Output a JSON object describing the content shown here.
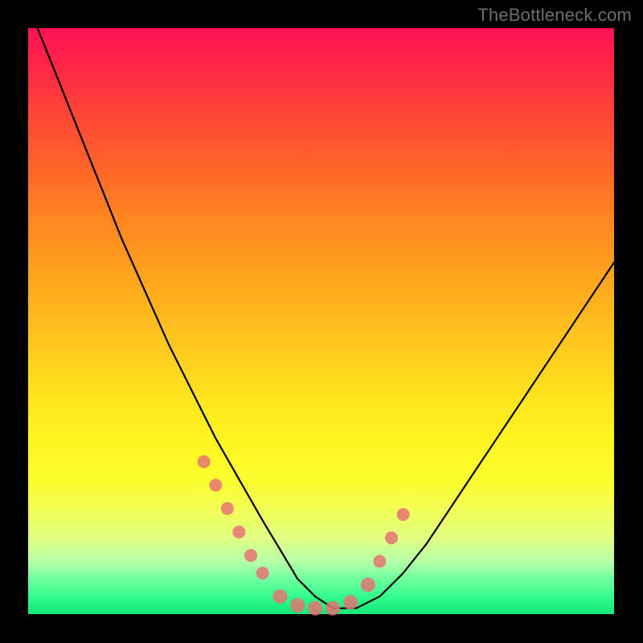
{
  "watermark": "TheBottleneck.com",
  "chart_data": {
    "type": "line",
    "title": "",
    "xlabel": "",
    "ylabel": "",
    "xlim": [
      0,
      100
    ],
    "ylim": [
      0,
      100
    ],
    "grid": false,
    "series": [
      {
        "name": "bottleneck-curve",
        "color": "#000000",
        "x": [
          0,
          4,
          8,
          12,
          16,
          20,
          24,
          28,
          32,
          36,
          40,
          43,
          46,
          49,
          52,
          56,
          60,
          64,
          68,
          72,
          76,
          80,
          84,
          88,
          92,
          96,
          100
        ],
        "values": [
          104,
          94,
          84,
          74,
          64,
          55,
          46,
          38,
          30,
          23,
          16,
          11,
          6,
          3,
          1,
          1,
          3,
          7,
          12,
          18,
          24,
          30,
          36,
          42,
          48,
          54,
          60
        ]
      }
    ],
    "markers": {
      "name": "highlighted-points",
      "color": "#e57373",
      "points": [
        {
          "x": 30,
          "y": 26
        },
        {
          "x": 32,
          "y": 22
        },
        {
          "x": 34,
          "y": 18
        },
        {
          "x": 36,
          "y": 14
        },
        {
          "x": 38,
          "y": 10
        },
        {
          "x": 40,
          "y": 7
        },
        {
          "x": 43,
          "y": 3
        },
        {
          "x": 46,
          "y": 1.5
        },
        {
          "x": 49,
          "y": 1
        },
        {
          "x": 52,
          "y": 1
        },
        {
          "x": 55,
          "y": 2
        },
        {
          "x": 58,
          "y": 5
        },
        {
          "x": 60,
          "y": 9
        },
        {
          "x": 62,
          "y": 13
        },
        {
          "x": 64,
          "y": 17
        }
      ]
    },
    "annotations": []
  }
}
